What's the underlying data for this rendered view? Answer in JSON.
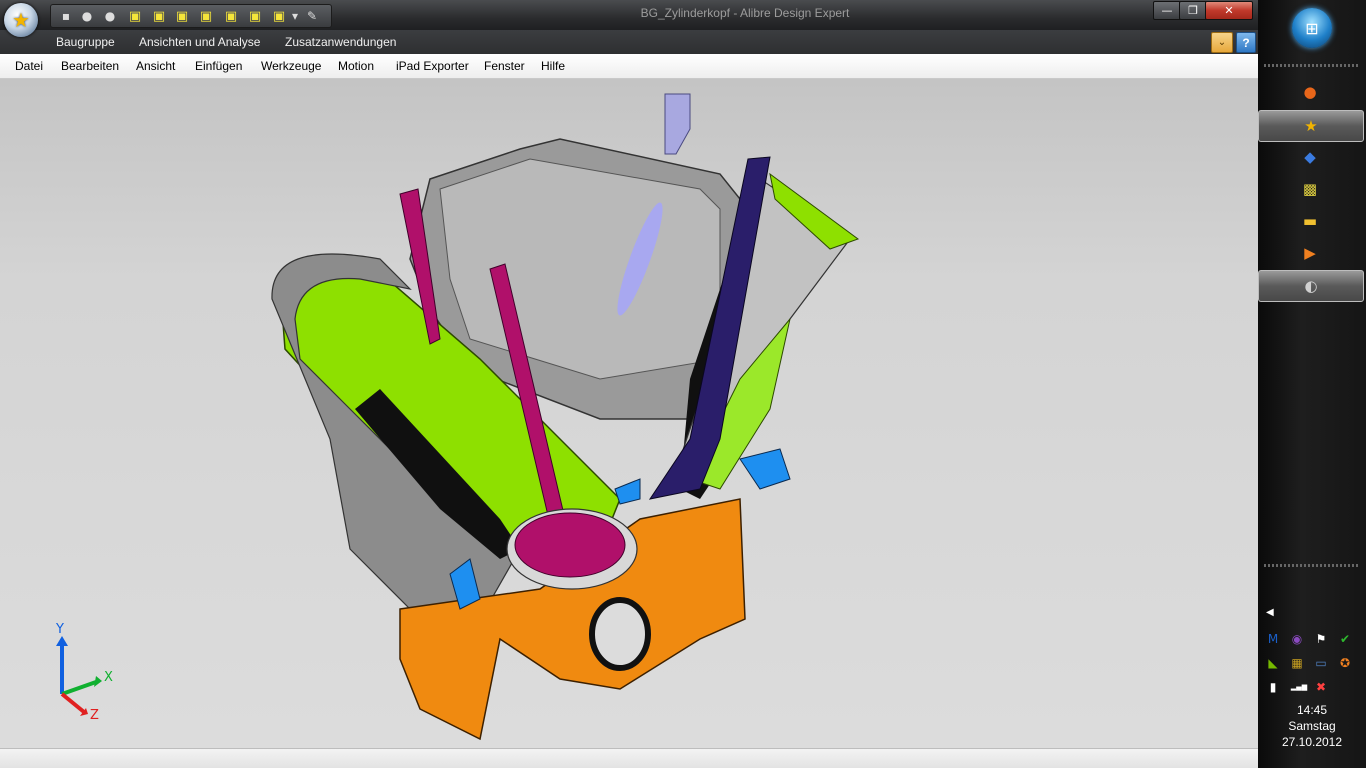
{
  "window": {
    "title": "BG_Zylinderkopf - Alibre Design Expert",
    "min_glyph": "—",
    "max_glyph": "❐",
    "close_glyph": "✕",
    "app_icon": "alibre-star-icon",
    "app_glyph": "★"
  },
  "quick_access": [
    {
      "name": "save-icon",
      "glyph": "▪"
    },
    {
      "name": "undo-icon",
      "glyph": "●"
    },
    {
      "name": "redo-icon",
      "glyph": "●"
    },
    {
      "name": "view-cube-front-icon",
      "glyph": "▣"
    },
    {
      "name": "view-cube-back-icon",
      "glyph": "▣"
    },
    {
      "name": "view-cube-top-icon",
      "glyph": "▣"
    },
    {
      "name": "view-cube-bottom-icon",
      "glyph": "▣"
    },
    {
      "name": "view-cube-left-icon",
      "glyph": "▣"
    },
    {
      "name": "view-cube-right-icon",
      "glyph": "▣"
    },
    {
      "name": "view-cube-iso-icon",
      "glyph": "▣"
    },
    {
      "name": "qat-customize-icon",
      "glyph": "▾"
    },
    {
      "name": "measure-icon",
      "glyph": "✎"
    }
  ],
  "ribbon_tabs": [
    "Baugruppe",
    "Ansichten und Analyse",
    "Zusatzanwendungen"
  ],
  "ribbon_right": {
    "expand_glyph": "⌄",
    "help_glyph": "?"
  },
  "menu": [
    "Datei",
    "Bearbeiten",
    "Ansicht",
    "Einfügen",
    "Werkzeuge",
    "Motion",
    "iPad Exporter",
    "Fenster",
    "Hilfe"
  ],
  "axes": {
    "y": "Y",
    "x": "X",
    "z": "Z"
  },
  "colors": {
    "intake_port": "#8ee000",
    "exhaust_valve": "#b0106a",
    "intake_valve": "#2a1e6a",
    "piston": "#f08a10",
    "head_metal": "#9a9a9a",
    "water_jacket": "#1e8ff0",
    "section_black": "#101010"
  },
  "taskbar": {
    "start_icon": "windows-start-orb",
    "start_glyph": "⊞",
    "pinned": [
      {
        "name": "firefox-icon",
        "glyph": "●",
        "color": "#e8661a",
        "active": false
      },
      {
        "name": "alibre-icon",
        "glyph": "★",
        "color": "#f2b400",
        "active": true
      },
      {
        "name": "virtualbox-icon",
        "glyph": "◆",
        "color": "#3a7be0",
        "active": false
      },
      {
        "name": "chart-app-icon",
        "glyph": "▩",
        "color": "#e0d040",
        "active": false
      },
      {
        "name": "explorer-folder-icon",
        "glyph": "▬",
        "color": "#f0c030",
        "active": false
      },
      {
        "name": "media-player-icon",
        "glyph": "▶",
        "color": "#f08020",
        "active": false
      },
      {
        "name": "paint-icon",
        "glyph": "◐",
        "color": "#d0d0d0",
        "active": true
      }
    ],
    "tray": [
      {
        "name": "malwarebytes-icon",
        "glyph": "M",
        "color": "#1a5fc8"
      },
      {
        "name": "purple-app-icon",
        "glyph": "◉",
        "color": "#8a4ac0"
      },
      {
        "name": "action-center-flag-icon",
        "glyph": "⚑",
        "color": "#ffffff"
      },
      {
        "name": "sync-check-icon",
        "glyph": "✔",
        "color": "#2eb82e"
      },
      {
        "name": "nvidia-icon",
        "glyph": "◣",
        "color": "#76b900"
      },
      {
        "name": "app-grid-icon",
        "glyph": "▦",
        "color": "#c8a020"
      },
      {
        "name": "network-monitor-icon",
        "glyph": "▭",
        "color": "#5080c0"
      },
      {
        "name": "avast-icon",
        "glyph": "✪",
        "color": "#f08020"
      },
      {
        "name": "power-plug-icon",
        "glyph": "▮",
        "color": "#ffffff"
      },
      {
        "name": "signal-bars-icon",
        "glyph": "▂▄▆",
        "color": "#ffffff"
      },
      {
        "name": "volume-muted-icon",
        "glyph": "✖",
        "color": "#ff4040"
      }
    ],
    "tray_expand_glyph": "◀",
    "time": "14:45",
    "day": "Samstag",
    "date": "27.10.2012"
  }
}
